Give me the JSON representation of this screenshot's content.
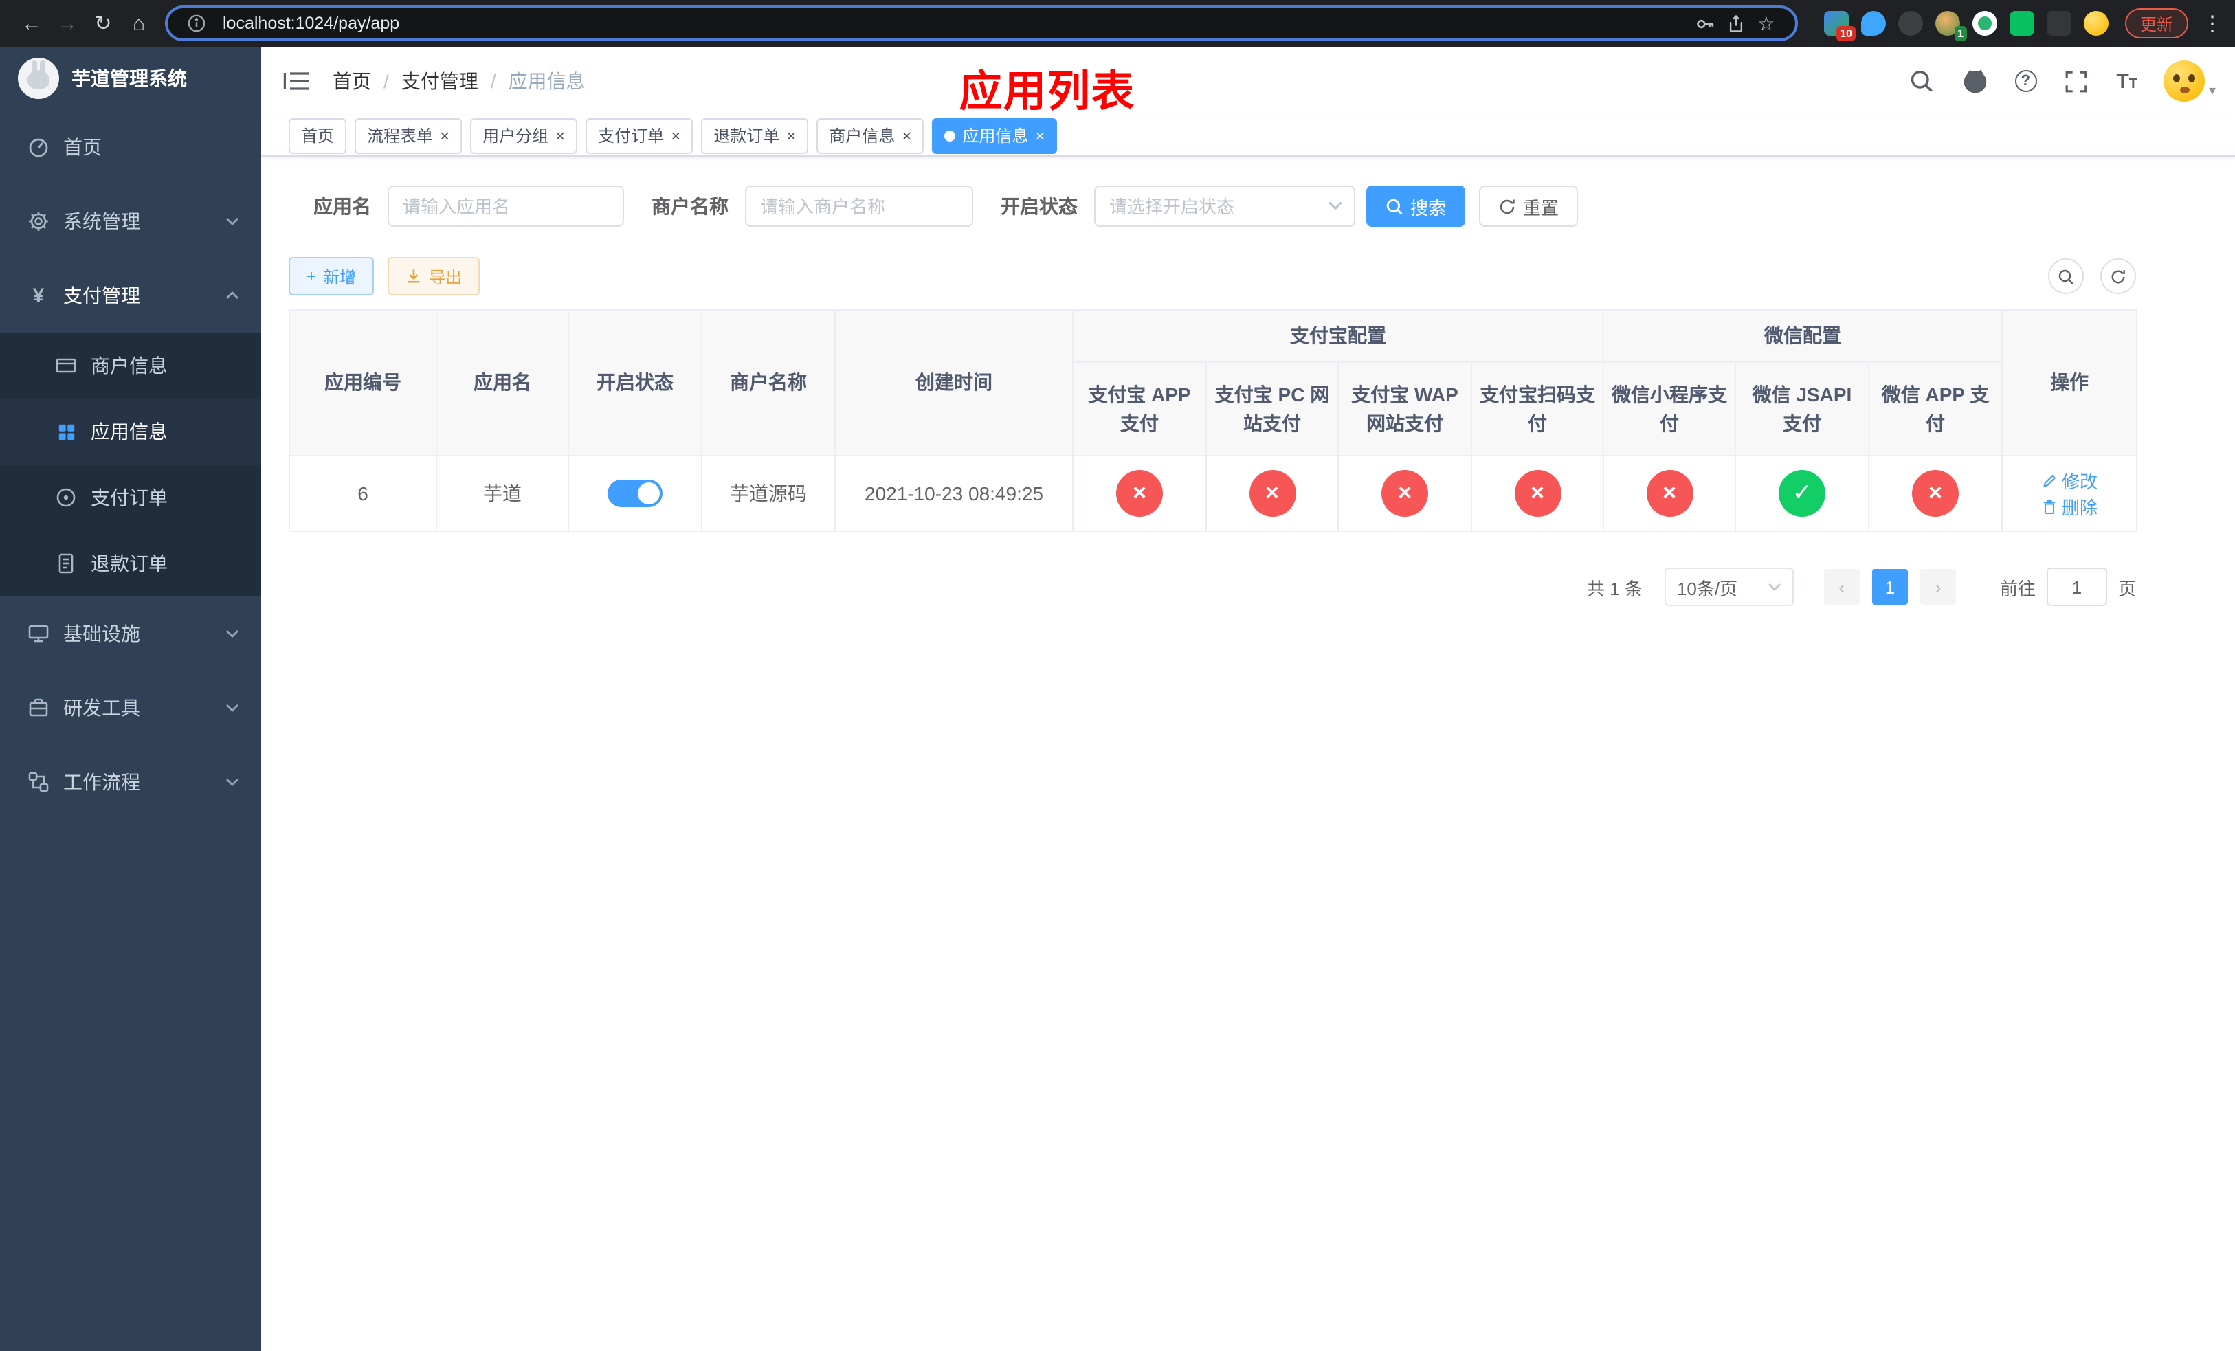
{
  "browser": {
    "url": "localhost:1024/pay/app",
    "update_label": "更新",
    "ext_badge_red": "10",
    "ext_badge_green": "1"
  },
  "icons": {
    "back": "←",
    "forward": "→",
    "reload": "↻",
    "home": "⌂",
    "star": "☆",
    "menu_dots": "⋮",
    "tab_close": "×",
    "caret_down": "▾",
    "prev": "‹",
    "next": "›",
    "yen": "¥",
    "plus": "+",
    "cross": "×",
    "check": "✓",
    "question": "?",
    "font_large": "T",
    "font_small": "T"
  },
  "sidebar": {
    "title": "芋道管理系统",
    "home": "首页",
    "system": "系统管理",
    "payment": "支付管理",
    "infra": "基础设施",
    "devtools": "研发工具",
    "workflow": "工作流程",
    "payment_children": [
      "商户信息",
      "应用信息",
      "支付订单",
      "退款订单"
    ]
  },
  "header": {
    "breadcrumb": [
      "首页",
      "支付管理",
      "应用信息"
    ],
    "separator": "/",
    "annotation": "应用列表"
  },
  "tabs": [
    {
      "label": "首页"
    },
    {
      "label": "流程表单"
    },
    {
      "label": "用户分组"
    },
    {
      "label": "支付订单"
    },
    {
      "label": "退款订单"
    },
    {
      "label": "商户信息"
    },
    {
      "label": "应用信息"
    }
  ],
  "filters": {
    "app_name_label": "应用名",
    "app_name_placeholder": "请输入应用名",
    "merchant_label": "商户名称",
    "merchant_placeholder": "请输入商户名称",
    "status_label": "开启状态",
    "status_placeholder": "请选择开启状态",
    "search_label": "搜索",
    "reset_label": "重置"
  },
  "toolbar": {
    "add_label": "新增",
    "export_label": "导出"
  },
  "table": {
    "col_id": "应用编号",
    "col_name": "应用名",
    "col_status": "开启状态",
    "col_merchant": "商户名称",
    "col_created": "创建时间",
    "col_actions": "操作",
    "alipay_group": "支付宝配置",
    "wechat_group": "微信配置",
    "alipay_cols": [
      "支付宝 APP 支付",
      "支付宝 PC 网站支付",
      "支付宝 WAP 网站支付",
      "支付宝扫码支付"
    ],
    "wechat_cols": [
      "微信小程序支付",
      "微信 JSAPI 支付",
      "微信 APP 支付"
    ],
    "row": {
      "id": "6",
      "name": "芋道",
      "status_on": true,
      "merchant": "芋道源码",
      "created": "2021-10-23 08:49:25",
      "configs": [
        false,
        false,
        false,
        false,
        false,
        true,
        false
      ],
      "edit_label": "修改",
      "delete_label": "删除"
    }
  },
  "pagination": {
    "total": "共 1 条",
    "page_size": "10条/页",
    "page": "1",
    "goto_prefix": "前往",
    "goto_value": "1",
    "goto_suffix": "页"
  }
}
